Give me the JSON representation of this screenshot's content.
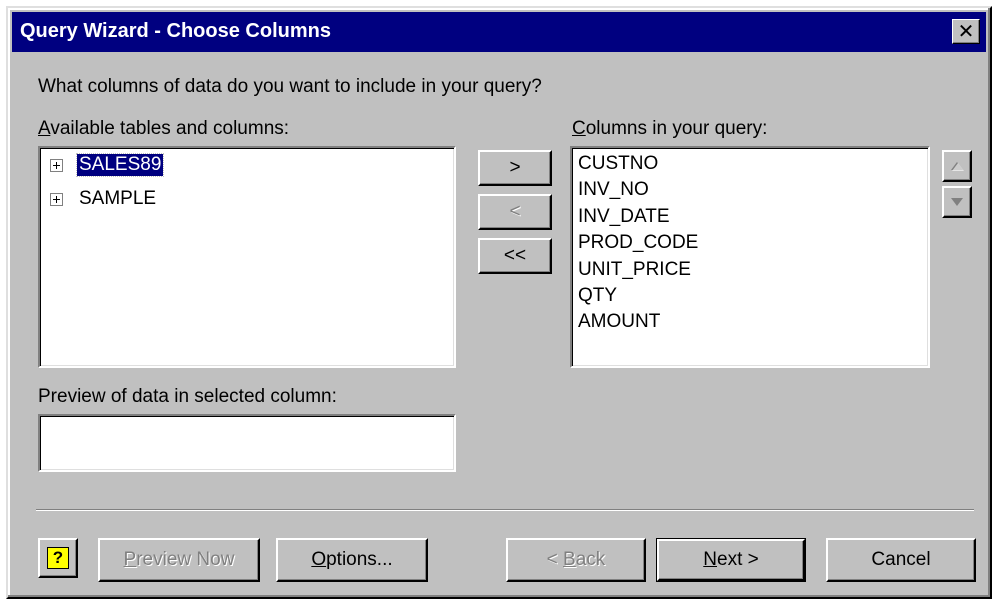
{
  "window": {
    "title": "Query Wizard - Choose Columns",
    "close_glyph": "✕"
  },
  "prompt": "What columns of data do you want to include in your query?",
  "available": {
    "label_key": "A",
    "label_rest": "vailable tables and columns:",
    "items": [
      {
        "label": "SALES89",
        "selected": true
      },
      {
        "label": "SAMPLE",
        "selected": false
      }
    ]
  },
  "query_columns": {
    "label_key": "C",
    "label_rest": "olumns in your query:",
    "items": [
      "CUSTNO",
      "INV_NO",
      "INV_DATE",
      "PROD_CODE",
      "UNIT_PRICE",
      "QTY",
      "AMOUNT"
    ]
  },
  "move_buttons": {
    "add": ">",
    "remove": "<",
    "remove_all": "<<"
  },
  "preview": {
    "label": "Preview of data in selected column:",
    "value": ""
  },
  "footer": {
    "help_glyph": "?",
    "preview_now": {
      "key": "P",
      "rest": "review Now"
    },
    "options": {
      "key": "O",
      "rest": "ptions..."
    },
    "back": {
      "prefix": "< ",
      "key": "B",
      "rest": "ack"
    },
    "next": {
      "key": "N",
      "rest": "ext >"
    },
    "cancel": "Cancel"
  },
  "colors": {
    "face": "#c0c0c0",
    "title_bar": "#000080",
    "selection": "#000080",
    "disabled_text": "#808080"
  }
}
